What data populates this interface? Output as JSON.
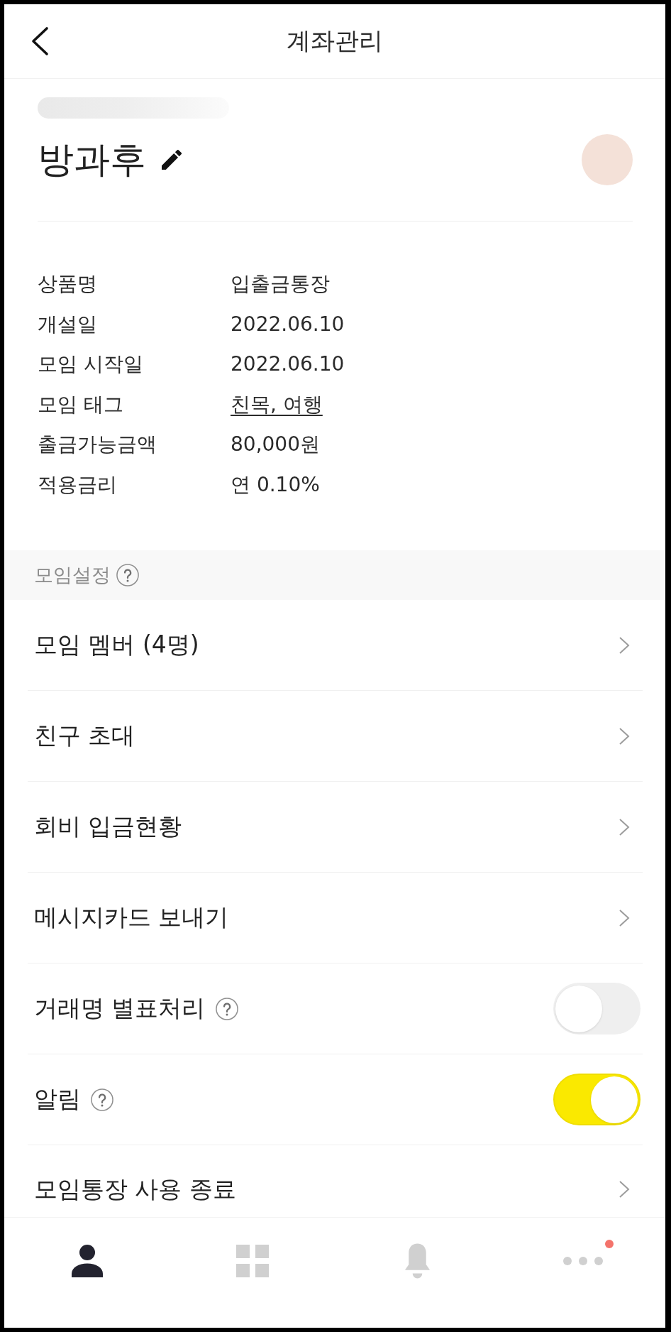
{
  "header": {
    "title": "계좌관리"
  },
  "account": {
    "name": "방과후"
  },
  "details": [
    {
      "label": "상품명",
      "value": "입출금통장",
      "kind": "text"
    },
    {
      "label": "개설일",
      "value": "2022.06.10",
      "kind": "text"
    },
    {
      "label": "모임 시작일",
      "value": "2022.06.10",
      "kind": "text"
    },
    {
      "label": "모임 태그",
      "value": "친목, 여행",
      "kind": "link"
    },
    {
      "label": "출금가능금액",
      "value": "80,000원",
      "kind": "text"
    },
    {
      "label": "적용금리",
      "value": "연 0.10%",
      "kind": "text"
    }
  ],
  "settings_section": {
    "title": "모임설정",
    "help": true
  },
  "settings": [
    {
      "label": "모임 멤버 (4명)",
      "kind": "link",
      "help": false
    },
    {
      "label": "친구 초대",
      "kind": "link",
      "help": false
    },
    {
      "label": "회비 입금현황",
      "kind": "link",
      "help": false
    },
    {
      "label": "메시지카드 보내기",
      "kind": "link",
      "help": false
    },
    {
      "label": "거래명 별표처리",
      "kind": "toggle",
      "help": true,
      "on": false
    },
    {
      "label": "알림",
      "kind": "toggle",
      "help": true,
      "on": true
    },
    {
      "label": "모임통장 사용 종료",
      "kind": "link",
      "help": false
    }
  ],
  "tab_bar": [
    {
      "kind": "person",
      "selected": true,
      "badge": false
    },
    {
      "kind": "grid",
      "selected": false,
      "badge": false
    },
    {
      "kind": "bell",
      "selected": false,
      "badge": false
    },
    {
      "kind": "more",
      "selected": false,
      "badge": true
    }
  ]
}
